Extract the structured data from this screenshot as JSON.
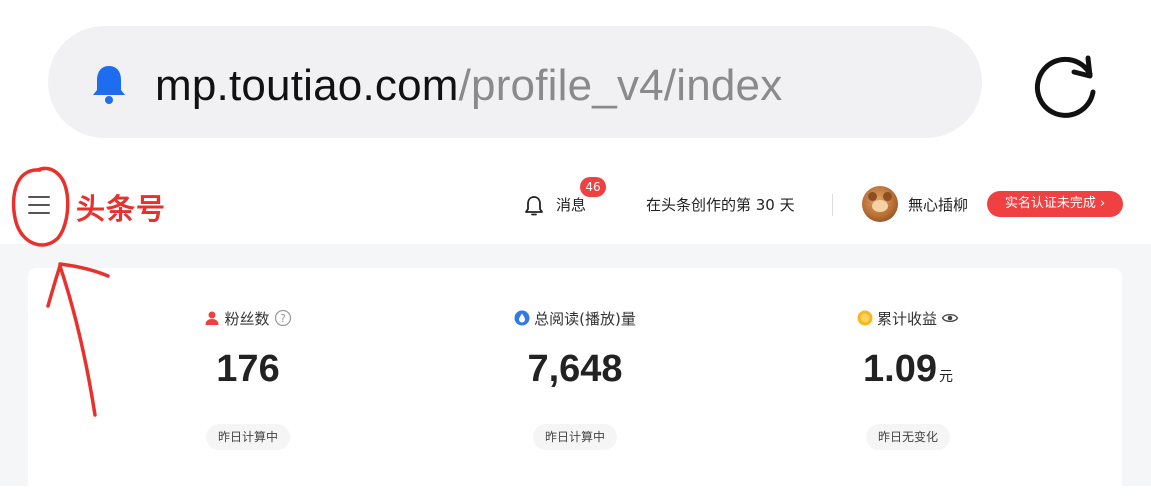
{
  "browser": {
    "url_domain": "mp.toutiao.com",
    "url_path": "/profile_v4/index",
    "notification_icon": "bell-icon",
    "reload_icon": "reload-icon"
  },
  "header": {
    "logo": "头条号",
    "messages_label": "消息",
    "messages_badge": "46",
    "creation_days": "在头条创作的第 30 天",
    "username": "無心插柳",
    "verify_label": "实名认证未完成 ›"
  },
  "stats": [
    {
      "label": "粉丝数",
      "icon": "person-icon",
      "value": "176",
      "unit": "",
      "note": "昨日计算中"
    },
    {
      "label": "总阅读(播放)量",
      "icon": "drop-icon",
      "value": "7,648",
      "unit": "",
      "note": "昨日计算中"
    },
    {
      "label": "累计收益",
      "icon": "coin-icon",
      "value": "1.09",
      "unit": "元",
      "note": "昨日无变化"
    }
  ],
  "colors": {
    "brand_red": "#e8302d",
    "badge_red": "#f04142",
    "bell_blue": "#1e6cf0",
    "annotation_red": "#e8302d"
  }
}
